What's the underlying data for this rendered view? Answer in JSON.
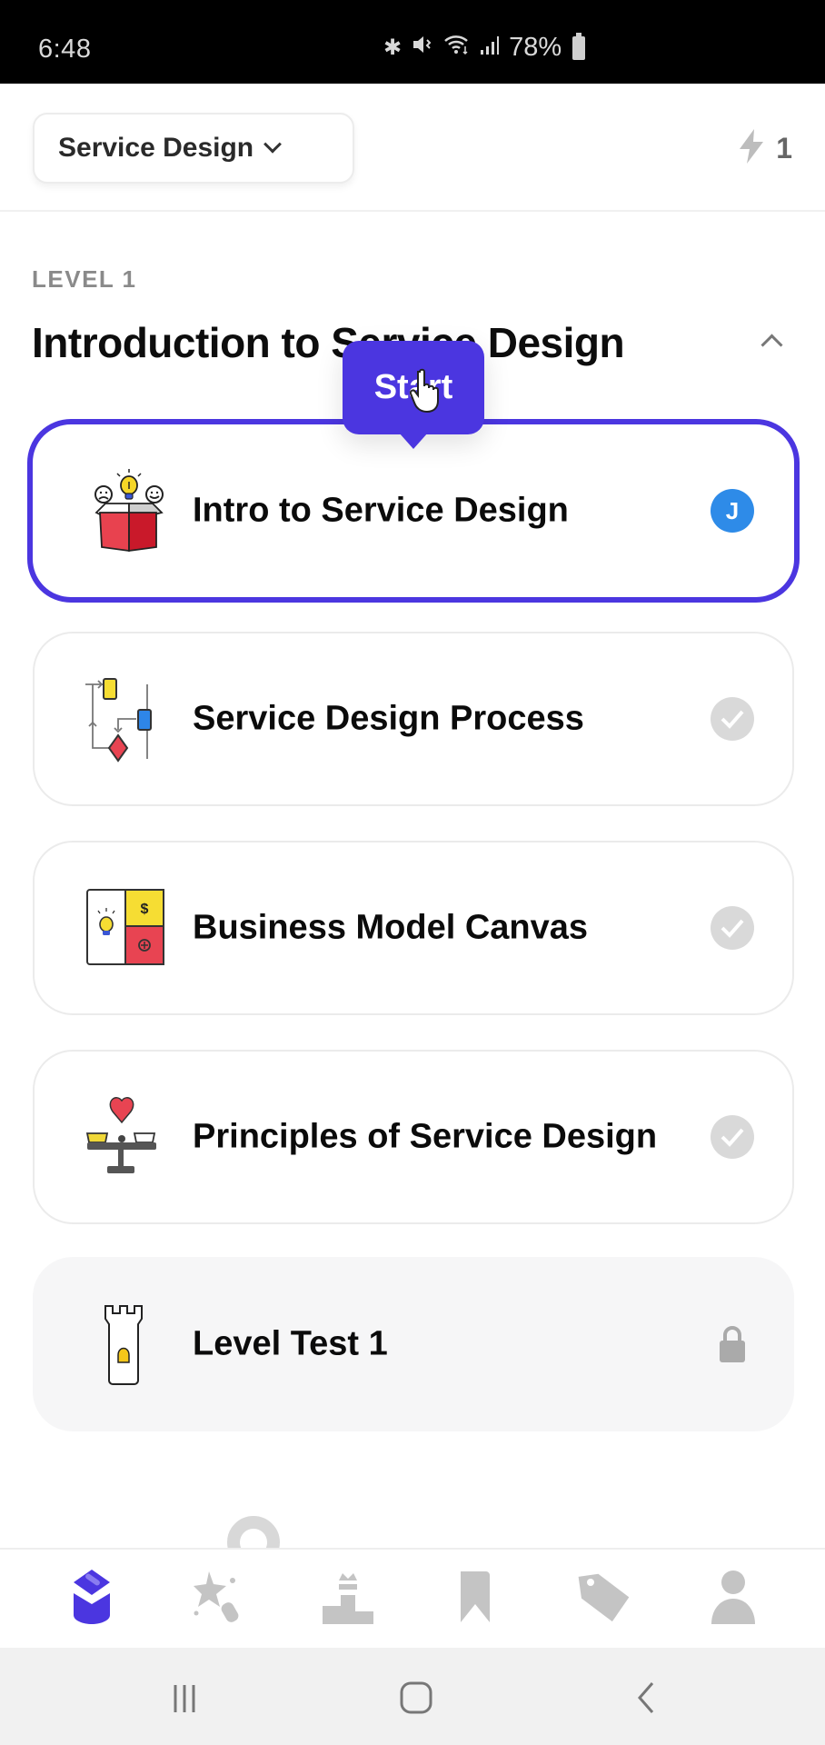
{
  "status_bar": {
    "time": "6:48",
    "battery": "78%",
    "icons": [
      "bluetooth-icon",
      "mute-icon",
      "wifi-icon",
      "signal-icon",
      "battery-icon"
    ]
  },
  "header": {
    "course": "Service Design",
    "streak_count": "1",
    "streak_icon": "lightning-icon"
  },
  "level": {
    "label": "LEVEL 1",
    "title": "Introduction to Service Design",
    "expanded": true
  },
  "tooltip": {
    "label": "Start"
  },
  "lessons": [
    {
      "title": "Intro to Service Design",
      "state": "current",
      "badge": "J",
      "icon": "open-box-ideas-icon"
    },
    {
      "title": "Service Design Process",
      "state": "completed",
      "icon": "flowchart-icon"
    },
    {
      "title": "Business Model Canvas",
      "state": "completed",
      "icon": "canvas-icon"
    },
    {
      "title": "Principles of Service Design",
      "state": "completed",
      "icon": "balance-scale-heart-icon"
    },
    {
      "title": "Level Test 1",
      "state": "locked",
      "icon": "tower-icon"
    }
  ],
  "bottom_nav": {
    "active": "learn",
    "tabs": [
      {
        "id": "learn",
        "icon": "graduation-cap-icon"
      },
      {
        "id": "practice",
        "icon": "star-sparkle-icon"
      },
      {
        "id": "leaderboard",
        "icon": "podium-icon"
      },
      {
        "id": "saved",
        "icon": "bookmark-icon"
      },
      {
        "id": "offers",
        "icon": "tag-icon"
      },
      {
        "id": "profile",
        "icon": "user-icon"
      }
    ]
  },
  "colors": {
    "accent": "#4b36e0",
    "avatar": "#2e8be8",
    "inactive_icon": "#c4c4c4"
  }
}
